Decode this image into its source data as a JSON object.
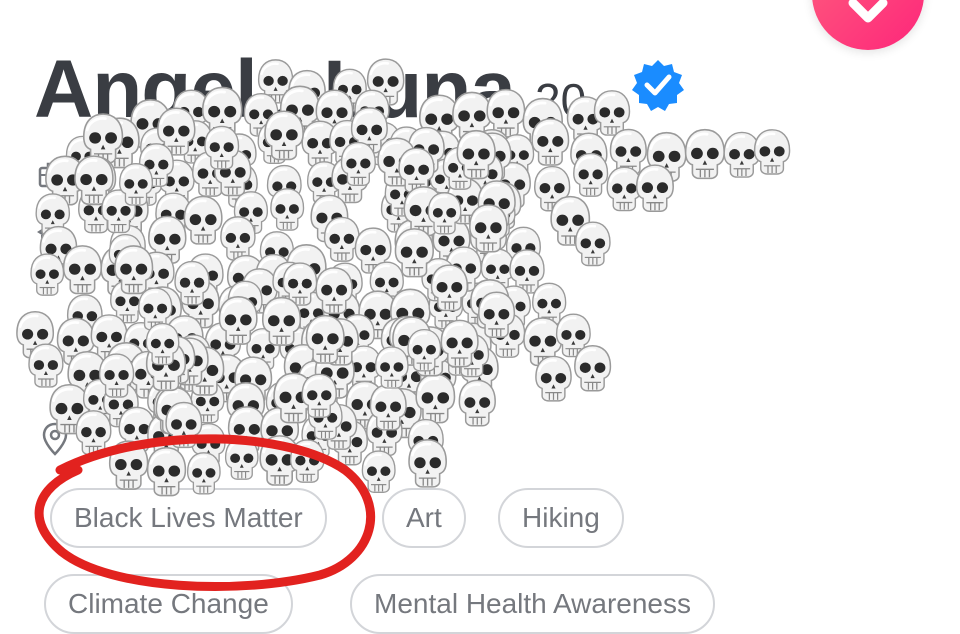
{
  "profile": {
    "name": "Angela Luna",
    "age": "20",
    "verified_color": "#1a8cff"
  },
  "passions": [
    "Black Lives Matter",
    "Art",
    "Hiking",
    "Climate Change",
    "Mental Health Awareness"
  ],
  "overlay": {
    "emoji": "💀",
    "highlight_color": "#e2221f"
  },
  "like_button": {
    "icon": "chevron-down-icon",
    "gradient": [
      "#ff5f7e",
      "#fd267a"
    ]
  }
}
